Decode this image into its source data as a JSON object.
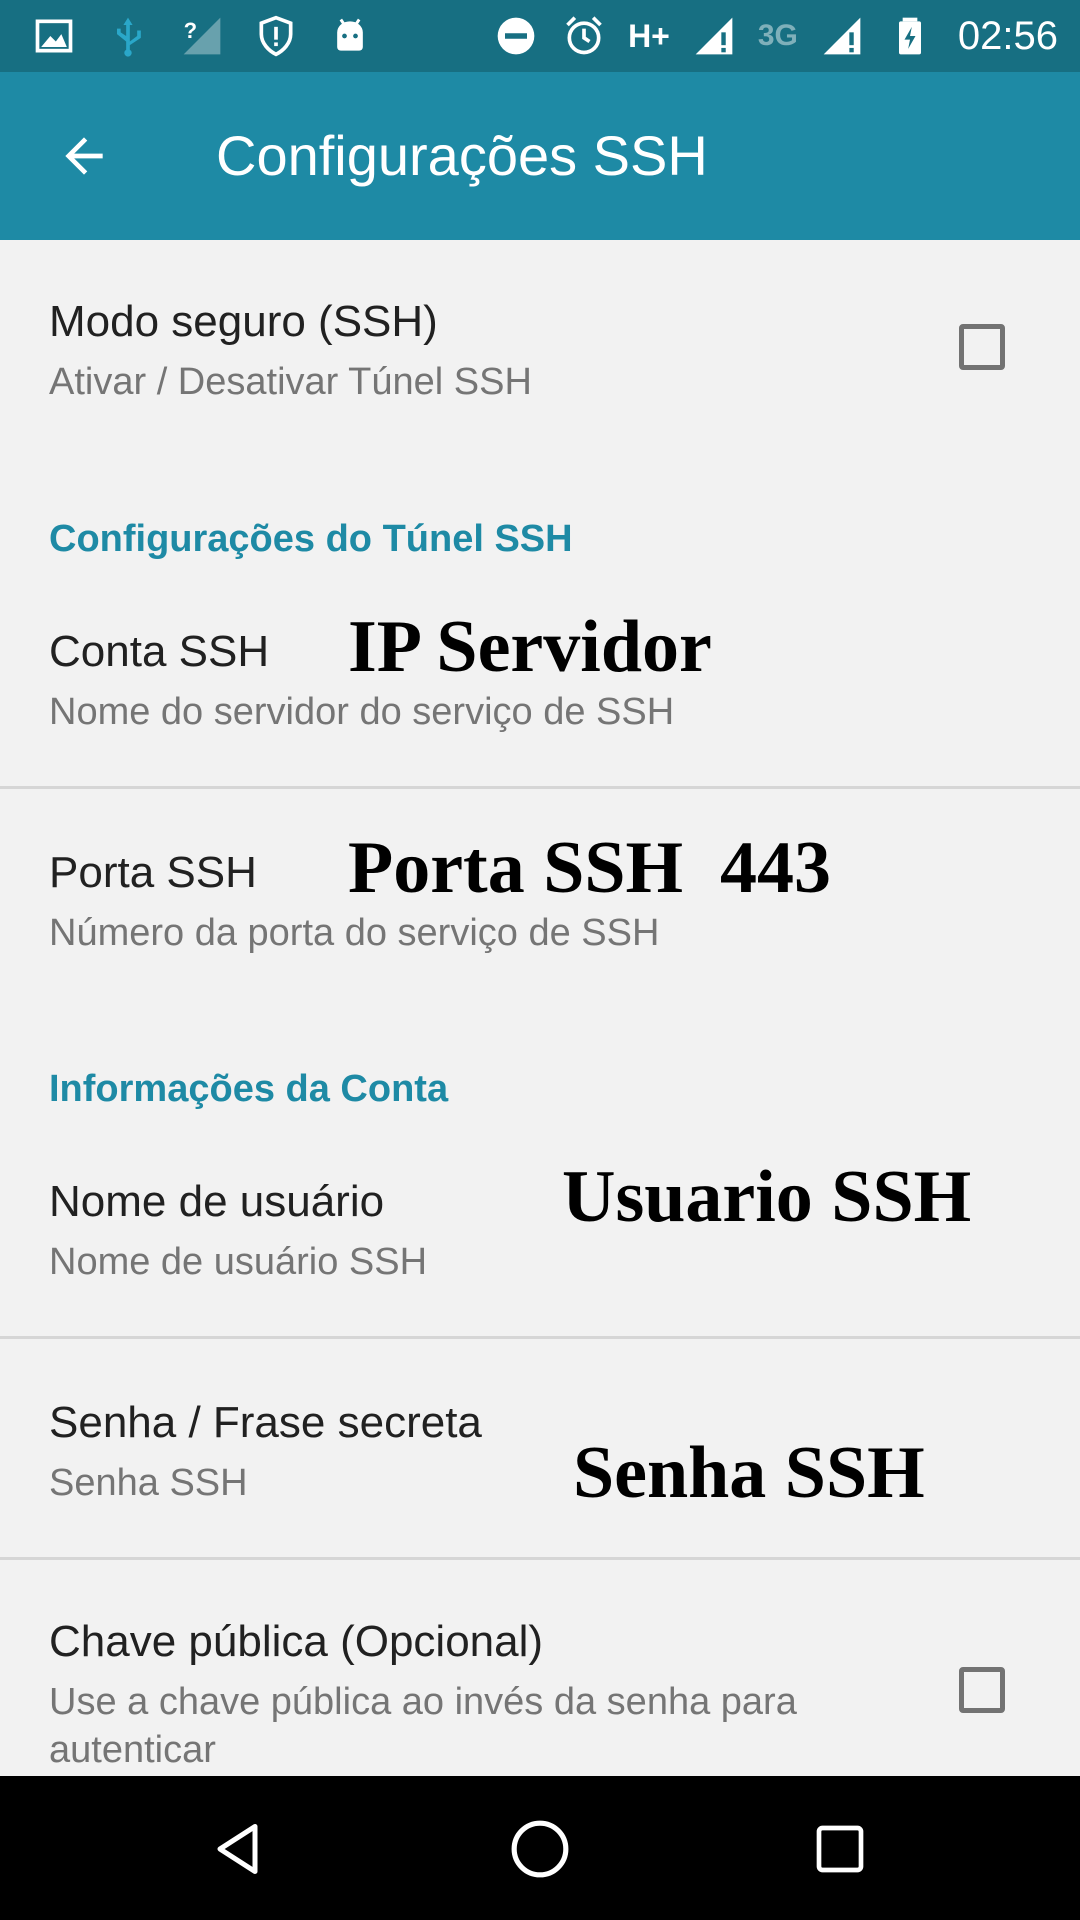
{
  "status_bar": {
    "left_icons": [
      "image-icon",
      "usb-icon",
      "no-signal-icon",
      "shield-icon",
      "android-icon"
    ],
    "right_icons": [
      "do-not-disturb-icon",
      "alarm-icon",
      "signal-icon",
      "battery-charging-icon"
    ],
    "network_primary": "H+",
    "network_secondary": "3G",
    "time": "02:56"
  },
  "toolbar": {
    "title": "Configurações SSH",
    "background": "#1e8aa5"
  },
  "settings": {
    "secure_mode": {
      "title": "Modo seguro (SSH)",
      "summary": "Ativar / Desativar Túnel SSH",
      "checked": false
    },
    "tunnel_category": "Configurações do Túnel SSH",
    "ssh_account": {
      "title": "Conta SSH",
      "summary": "Nome do servidor do serviço de SSH",
      "overlay": "IP Servidor"
    },
    "ssh_port": {
      "title": "Porta SSH",
      "summary": "Número da porta do serviço de SSH",
      "overlay": "Porta SSH  443"
    },
    "account_category": "Informações da Conta",
    "username": {
      "title": "Nome de usuário",
      "summary": "Nome de usuário SSH",
      "overlay": "Usuario SSH"
    },
    "password": {
      "title": "Senha / Frase secreta",
      "summary": "Senha SSH",
      "overlay": "Senha SSH"
    },
    "public_key": {
      "title": "Chave pública (Opcional)",
      "summary": "Use a chave pública ao invés da senha para autenticar",
      "checked": false
    }
  },
  "nav_bar": {
    "buttons": [
      "back-triangle-icon",
      "home-circle-icon",
      "recents-square-icon"
    ]
  },
  "colors": {
    "accent": "#1e8aa5",
    "status_bar": "#176f82",
    "background": "#f2f2f2"
  }
}
